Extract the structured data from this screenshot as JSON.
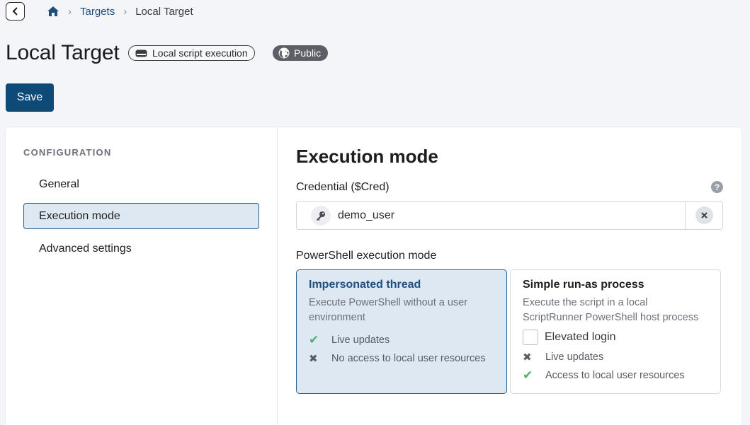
{
  "breadcrumb": {
    "back_label": "",
    "items": [
      "Targets",
      "Local Target"
    ]
  },
  "header": {
    "title": "Local Target",
    "type_badge": "Local script execution",
    "visibility_badge": "Public",
    "save_label": "Save"
  },
  "sidebar": {
    "heading": "CONFIGURATION",
    "items": [
      {
        "label": "General"
      },
      {
        "label": "Execution mode"
      },
      {
        "label": "Advanced settings"
      }
    ],
    "active_index": 1
  },
  "main": {
    "section_title": "Execution mode",
    "credential": {
      "label": "Credential ($Cred)",
      "help": "?",
      "value": "demo_user"
    },
    "mode_label": "PowerShell execution mode",
    "modes": [
      {
        "title": "Impersonated thread",
        "description": "Execute PowerShell without a user environment",
        "features": [
          {
            "icon": "check-icon",
            "text": "Live updates"
          },
          {
            "icon": "cross-icon",
            "text": "No access to local user resources"
          }
        ]
      },
      {
        "title": "Simple run-as process",
        "description": "Execute the script in a local ScriptRunner PowerShell host process",
        "elevated_label": "Elevated login",
        "features": [
          {
            "icon": "cross-icon",
            "text": "Live updates"
          },
          {
            "icon": "check-icon",
            "text": "Access to local user resources"
          }
        ]
      }
    ],
    "selected_mode": 0
  },
  "colors": {
    "primary": "#0e4a78",
    "selected_bg": "#dde8f2",
    "check": "#4caf6e"
  }
}
